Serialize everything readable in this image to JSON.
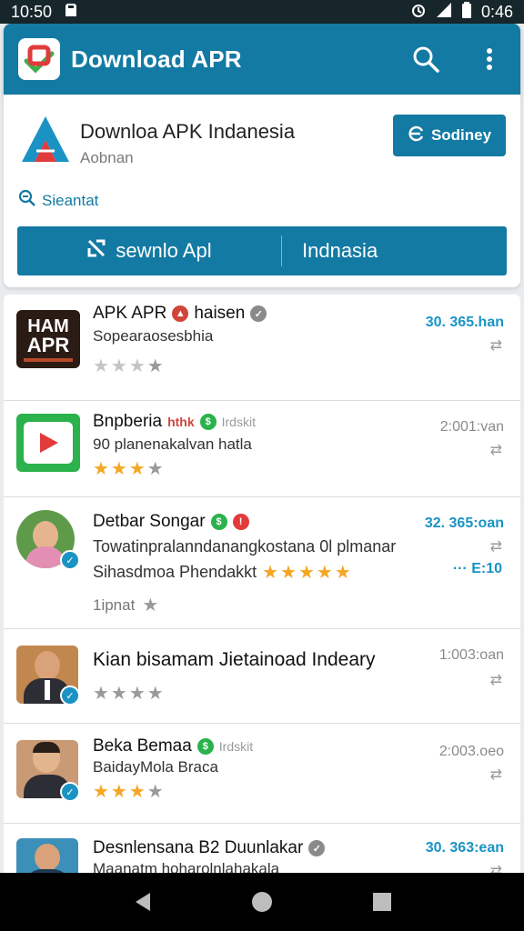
{
  "status_bar": {
    "time_left": "10:50",
    "time_right": "0:46"
  },
  "app_bar": {
    "title": "Download APR"
  },
  "header": {
    "title": "Downloa APK Indanesia",
    "subtitle": "Aobnan",
    "button_label": "Sodiney",
    "search_label": "Sieantat",
    "tab_left": "sewnlo Apl",
    "tab_right": "Indnasia"
  },
  "list": [
    {
      "title": "APK APR",
      "title_tag": "haisen",
      "subtitle": "Sopearaosesbhia",
      "count": "30. 365.han",
      "rating": 1,
      "thumb_lines": [
        "HAM",
        "APR"
      ]
    },
    {
      "title": "Bnpberia",
      "title_tag": "Irdskit",
      "title_red": "hthk",
      "subtitle": "90 planenakalvan hatla",
      "count": "2:001:van",
      "rating": 3
    },
    {
      "title": "Detbar Songar",
      "subtitle": "Towatinpralanndanangkostana 0l plmanar",
      "subtitle2": "Sihasdmoa Phendakkt",
      "count": "32. 365:oan",
      "count2": "··· E:10",
      "extra": "1ipnat",
      "rating": 5
    },
    {
      "title": "Kian bisamam Jietainoad Indeary",
      "count": "1:003:oan",
      "rating": 4
    },
    {
      "title": "Beka Bemaa",
      "title_tag": "Irdskit",
      "subtitle": "BaidayMola Braca",
      "count": "2:003.oeo",
      "rating": 3
    },
    {
      "title": "Desnlensana B2 Duunlakar",
      "subtitle": "Maanatm hoharolnlahakala",
      "count": "30. 363:ean"
    }
  ]
}
